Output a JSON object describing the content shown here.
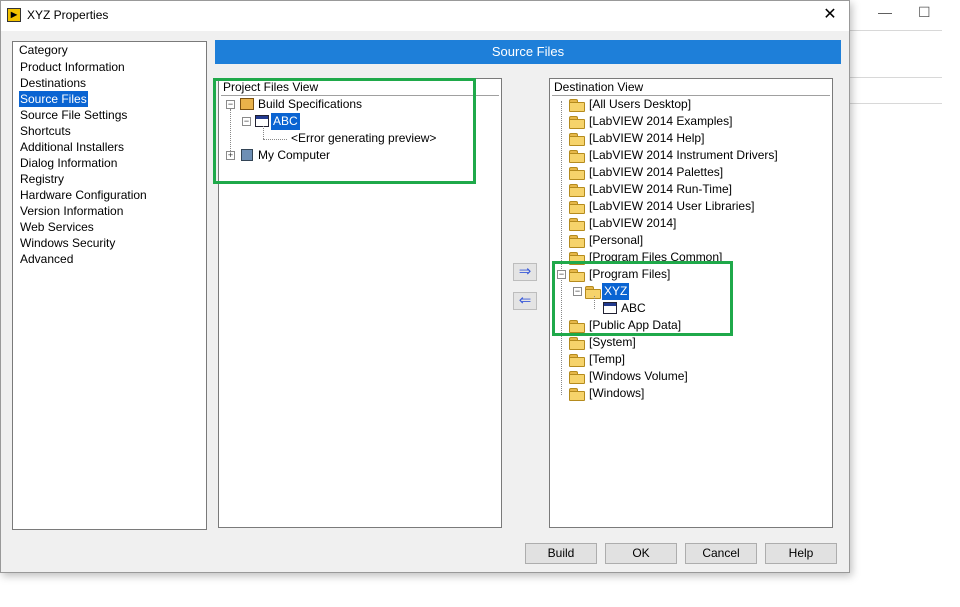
{
  "window": {
    "title": "XYZ Properties",
    "close_label": "✕"
  },
  "background_window": {
    "minimize": "—",
    "maximize": "☐"
  },
  "category": {
    "header": "Category",
    "selected_index": 2,
    "items": [
      "Product Information",
      "Destinations",
      "Source Files",
      "Source File Settings",
      "Shortcuts",
      "Additional Installers",
      "Dialog Information",
      "Registry",
      "Hardware Configuration",
      "Version Information",
      "Web Services",
      "Windows Security",
      "Advanced"
    ]
  },
  "banner": {
    "title": "Source Files"
  },
  "project_view": {
    "title": "Project Files View",
    "build_specs": "Build Specifications",
    "abc": "ABC",
    "error": "<Error generating preview>",
    "my_computer": "My Computer"
  },
  "destination_view": {
    "title": "Destination View",
    "folders_top": [
      "[All Users Desktop]",
      "[LabVIEW 2014 Examples]",
      "[LabVIEW 2014 Help]",
      "[LabVIEW 2014 Instrument Drivers]",
      "[LabVIEW 2014 Palettes]",
      "[LabVIEW 2014 Run-Time]",
      "[LabVIEW 2014 User Libraries]",
      "[LabVIEW 2014]",
      "[Personal]",
      "[Program Files Common]"
    ],
    "program_files": "[Program Files]",
    "xyz": "XYZ",
    "abc": "ABC",
    "folders_bottom": [
      "[Public App Data]",
      "[System]",
      "[Temp]",
      "[Windows Volume]",
      "[Windows]"
    ]
  },
  "arrows": {
    "add": "⇒",
    "remove": "⇐"
  },
  "buttons": {
    "build": "Build",
    "ok": "OK",
    "cancel": "Cancel",
    "help": "Help"
  },
  "colors": {
    "banner": "#1e7fd9",
    "selection": "#0a64d2",
    "highlight": "#1fa94a"
  }
}
